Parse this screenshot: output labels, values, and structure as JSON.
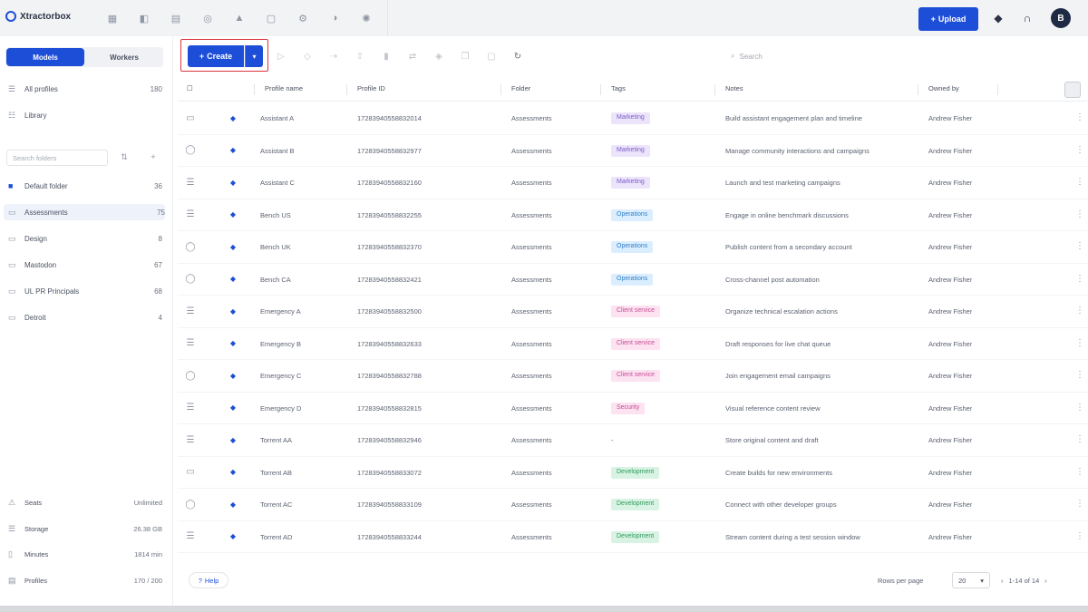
{
  "app": {
    "name": "Xtractorbox"
  },
  "topbar": {
    "tool_icons": [
      "grid-icon",
      "chat-icon",
      "document-icon",
      "compass-icon",
      "person-icon",
      "clipboard-icon",
      "gear-icon",
      "chart-icon",
      "settings-icon"
    ],
    "upload_label": "Upload",
    "avatar_initial": "B"
  },
  "sidebar": {
    "segments": [
      "Models",
      "Workers"
    ],
    "nav": [
      {
        "label": "All profiles",
        "count": "180"
      },
      {
        "label": "Library",
        "count": ""
      }
    ],
    "search_placeholder": "Search folders",
    "folders": [
      {
        "label": "Default folder",
        "count": "36"
      },
      {
        "label": "Assessments",
        "count": "75"
      },
      {
        "label": "Design",
        "count": "8"
      },
      {
        "label": "Mastodon",
        "count": "67"
      },
      {
        "label": "UL PR Principals",
        "count": "68"
      },
      {
        "label": "Detroit",
        "count": "4"
      }
    ],
    "footer": [
      {
        "label": "Seats",
        "value": "Unlimited"
      },
      {
        "label": "Storage",
        "value": "26.38 GB"
      },
      {
        "label": "Minutes",
        "value": "1814 min"
      },
      {
        "label": "Profiles",
        "value": "170 / 200"
      }
    ]
  },
  "toolbar": {
    "new_label": "Create",
    "search_placeholder": "Search"
  },
  "table": {
    "headers": [
      "Profile name",
      "Profile ID",
      "Folder",
      "Tags",
      "Notes",
      "Owned by"
    ],
    "rows": [
      {
        "name": "Assistant A",
        "id": "17283940558832014",
        "folder": "Assessments",
        "tag": "Marketing",
        "tag_kind": "purple",
        "notes": "Build assistant engagement plan and timeline",
        "owner": "Andrew Fisher"
      },
      {
        "name": "Assistant B",
        "id": "17283940558832977",
        "folder": "Assessments",
        "tag": "Marketing",
        "tag_kind": "purple",
        "notes": "Manage community interactions and campaigns",
        "owner": "Andrew Fisher"
      },
      {
        "name": "Assistant C",
        "id": "17283940558832160",
        "folder": "Assessments",
        "tag": "Marketing",
        "tag_kind": "purple",
        "notes": "Launch and test marketing campaigns",
        "owner": "Andrew Fisher"
      },
      {
        "name": "Bench US",
        "id": "17283940558832255",
        "folder": "Assessments",
        "tag": "Operations",
        "tag_kind": "blue",
        "notes": "Engage in online benchmark discussions",
        "owner": "Andrew Fisher"
      },
      {
        "name": "Bench UK",
        "id": "17283940558832370",
        "folder": "Assessments",
        "tag": "Operations",
        "tag_kind": "blue",
        "notes": "Publish content from a secondary account",
        "owner": "Andrew Fisher"
      },
      {
        "name": "Bench CA",
        "id": "17283940558832421",
        "folder": "Assessments",
        "tag": "Operations",
        "tag_kind": "blue",
        "notes": "Cross-channel post automation",
        "owner": "Andrew Fisher"
      },
      {
        "name": "Emergency A",
        "id": "17283940558832500",
        "folder": "Assessments",
        "tag": "Client service",
        "tag_kind": "pink",
        "notes": "Organize technical escalation actions",
        "owner": "Andrew Fisher"
      },
      {
        "name": "Emergency B",
        "id": "17283940558832633",
        "folder": "Assessments",
        "tag": "Client service",
        "tag_kind": "pink",
        "notes": "Draft responses for live chat queue",
        "owner": "Andrew Fisher"
      },
      {
        "name": "Emergency C",
        "id": "17283940558832788",
        "folder": "Assessments",
        "tag": "Client service",
        "tag_kind": "pink",
        "notes": "Join engagement email campaigns",
        "owner": "Andrew Fisher"
      },
      {
        "name": "Emergency D",
        "id": "17283940558832815",
        "folder": "Assessments",
        "tag": "Security",
        "tag_kind": "pink",
        "notes": "Visual reference content review",
        "owner": "Andrew Fisher"
      },
      {
        "name": "Torrent AA",
        "id": "17283940558832946",
        "folder": "Assessments",
        "tag": "-",
        "tag_kind": "none",
        "notes": "Store original content and draft",
        "owner": "Andrew Fisher"
      },
      {
        "name": "Torrent AB",
        "id": "17283940558833072",
        "folder": "Assessments",
        "tag": "Development",
        "tag_kind": "green",
        "notes": "Create builds for new environments",
        "owner": "Andrew Fisher"
      },
      {
        "name": "Torrent AC",
        "id": "17283940558833109",
        "folder": "Assessments",
        "tag": "Development",
        "tag_kind": "green",
        "notes": "Connect with other developer groups",
        "owner": "Andrew Fisher"
      },
      {
        "name": "Torrent AD",
        "id": "17283940558833244",
        "folder": "Assessments",
        "tag": "Development",
        "tag_kind": "green",
        "notes": "Stream content during a test session window",
        "owner": "Andrew Fisher"
      }
    ]
  },
  "footer": {
    "help_label": "Help",
    "rows_per_page_label": "Rows per page",
    "rows_per_page_value": "20",
    "pagination": "1-14 of 14"
  },
  "colors": {
    "accent": "#1d4ed8",
    "highlight_border": "#d9363e",
    "tag_purple_bg": "#ece4fb",
    "tag_purple_fg": "#7b5bc7",
    "tag_blue_bg": "#dbeeff",
    "tag_blue_fg": "#2f7fc8",
    "tag_pink_bg": "#fde2f1",
    "tag_pink_fg": "#c44d92",
    "tag_green_bg": "#d8f3e3",
    "tag_green_fg": "#2f9a5c"
  }
}
